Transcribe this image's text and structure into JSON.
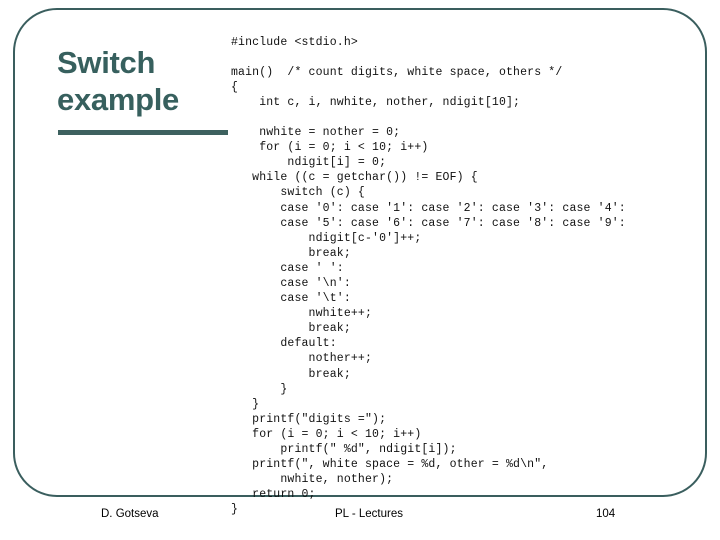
{
  "slide": {
    "frame_color": "#3a5e5e",
    "title": "Switch example",
    "title_color": "#37605e",
    "background_color": "#ffffff"
  },
  "code": {
    "language": "c",
    "text": "#include <stdio.h>\n\nmain()  /* count digits, white space, others */\n{\n    int c, i, nwhite, nother, ndigit[10];\n\n    nwhite = nother = 0;\n    for (i = 0; i < 10; i++)\n        ndigit[i] = 0;\n   while ((c = getchar()) != EOF) {\n       switch (c) {\n       case '0': case '1': case '2': case '3': case '4':\n       case '5': case '6': case '7': case '8': case '9':\n           ndigit[c-'0']++;\n           break;\n       case ' ':\n       case '\\n':\n       case '\\t':\n           nwhite++;\n           break;\n       default:\n           nother++;\n           break;\n       }\n   }\n   printf(\"digits =\");\n   for (i = 0; i < 10; i++)\n       printf(\" %d\", ndigit[i]);\n   printf(\", white space = %d, other = %d\\n\",\n       nwhite, nother);\n   return 0;\n}"
  },
  "footer": {
    "author": "D. Gotseva",
    "course": "PL - Lectures",
    "page_number": "104"
  }
}
